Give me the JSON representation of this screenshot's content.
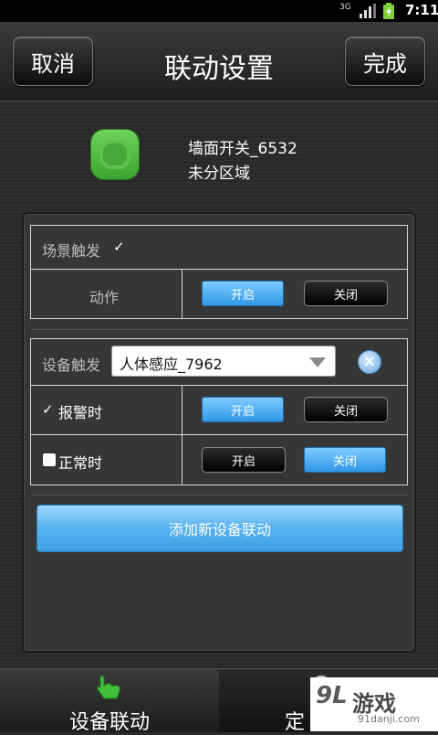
{
  "status_bar": {
    "network": "3G",
    "time": "7:11"
  },
  "header": {
    "cancel_label": "取消",
    "title": "联动设置",
    "done_label": "完成"
  },
  "device": {
    "name": "墙面开关_6532",
    "area": "未分区域",
    "icon": "switch-icon",
    "icon_color": "#4fbf3f"
  },
  "scene_trigger": {
    "label": "场景触发",
    "checked": true,
    "action_label": "动作",
    "on_label": "开启",
    "off_label": "关闭",
    "selected": "开启"
  },
  "device_trigger": {
    "label": "设备触发",
    "selected_device": "人体感应_7962",
    "alarm": {
      "label": "报警时",
      "checked": true,
      "on_label": "开启",
      "off_label": "关闭",
      "selected": "开启"
    },
    "normal": {
      "label": "正常时",
      "checked": false,
      "on_label": "开启",
      "off_label": "关闭",
      "selected": "关闭"
    }
  },
  "add_button_label": "添加新设备联动",
  "tabs": [
    {
      "label": "设备联动",
      "icon": "hand-pointer-icon",
      "active": true
    },
    {
      "label": "定",
      "icon": "clock-icon",
      "active": false
    }
  ],
  "watermark": {
    "logo": "9L",
    "text": "游戏",
    "url": "91danji.com"
  },
  "colors": {
    "accent_blue": "#3d9fe3",
    "background": "#2b2b2b"
  }
}
